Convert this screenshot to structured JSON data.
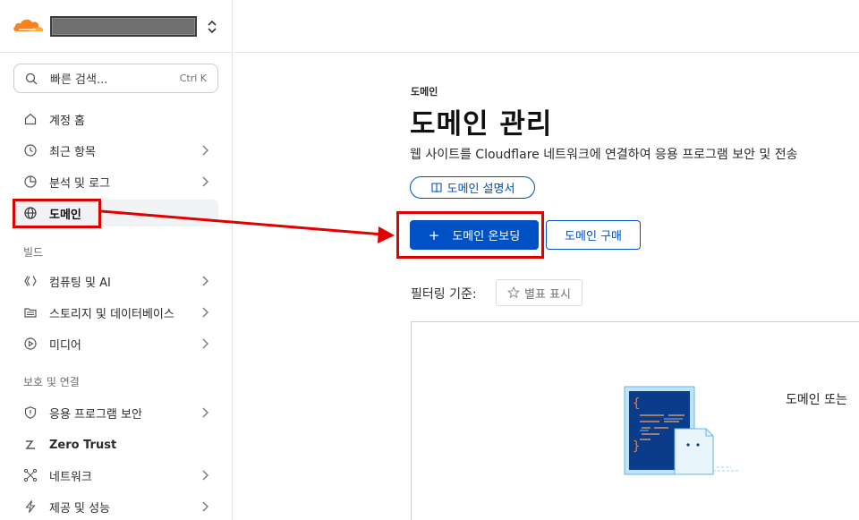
{
  "sidebar": {
    "search": {
      "placeholder": "빠른 검색...",
      "shortcut": "Ctrl K"
    },
    "items": [
      {
        "id": "home",
        "label": "계정 홈",
        "icon": "home-icon",
        "has_chevron": false
      },
      {
        "id": "recent",
        "label": "최근 항목",
        "icon": "clock-icon",
        "has_chevron": true
      },
      {
        "id": "analytics",
        "label": "분석 및 로그",
        "icon": "chart-pie-icon",
        "has_chevron": true
      },
      {
        "id": "domains",
        "label": "도메인",
        "icon": "globe-icon",
        "has_chevron": false,
        "active": true
      }
    ],
    "build_label": "빌드",
    "build_items": [
      {
        "id": "compute",
        "label": "컴퓨팅 및 AI",
        "icon": "compute-icon",
        "has_chevron": true
      },
      {
        "id": "storage",
        "label": "스토리지 및 데이터베이스",
        "icon": "storage-icon",
        "has_chevron": true
      },
      {
        "id": "media",
        "label": "미디어",
        "icon": "play-icon",
        "has_chevron": true
      }
    ],
    "protect_label": "보호 및 연결",
    "protect_items": [
      {
        "id": "appsec",
        "label": "응용 프로그램 보안",
        "icon": "shield-icon",
        "has_chevron": true
      },
      {
        "id": "zerotrust",
        "label": "Zero Trust",
        "icon": "zero-trust-icon",
        "has_chevron": false
      },
      {
        "id": "network",
        "label": "네트워크",
        "icon": "network-icon",
        "has_chevron": true
      },
      {
        "id": "delivery",
        "label": "제공 및 성능",
        "icon": "bolt-icon",
        "has_chevron": true
      }
    ]
  },
  "main": {
    "breadcrumb": "도메인",
    "title": "도메인 관리",
    "description": "웹 사이트를 Cloudflare 네트워크에 연결하여 응용 프로그램 보안 및 전송",
    "doc_button": "도메인 설명서",
    "onboard_button": "도메인 온보딩",
    "buy_button": "도메인 구매",
    "filter_label": "필터링 기준:",
    "starred_button": "별표 표시",
    "empty_text": "도메인 또는"
  },
  "colors": {
    "accent": "#0051c3",
    "highlight": "#e00000",
    "brand_orange": "#f6821f"
  }
}
